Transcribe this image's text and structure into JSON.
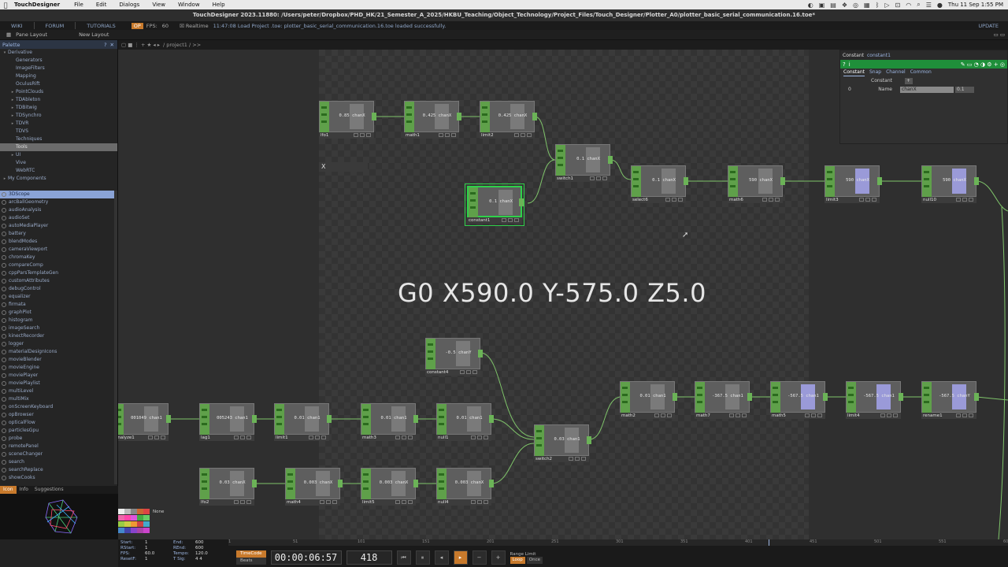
{
  "menubar": {
    "app_name": "TouchDesigner",
    "items": [
      "File",
      "Edit",
      "Dialogs",
      "View",
      "Window",
      "Help"
    ],
    "clock": "Thu 11 Sep  1:55 PM"
  },
  "window": {
    "title": "TouchDesigner 2023.11880: /Users/peter/Dropbox/PHD_HK/21_Semester_A_2025/HKBU_Teaching/Object_Technology/Project_Files/Touch_Designer/Plotter_A0/plotter_basic_serial_communication.16.toe*"
  },
  "toolbar1": {
    "wiki": "WIKI",
    "forum": "FORUM",
    "tutorials": "TUTORIALS",
    "badge": "OP",
    "fps_label": "FPS:",
    "fps_value": "60",
    "realtime": "Realtime",
    "status": "11:47:08 Load Project .toe: plotter_basic_serial_communication.16.toe loaded successfully.",
    "update": "UPDATE"
  },
  "toolbar2": {
    "pane_layout": "Pane Layout",
    "new_layout": "New Layout"
  },
  "pathbar": {
    "path": "/ project1 / >>"
  },
  "palette": {
    "title": "Palette",
    "tree": [
      {
        "label": "Derivative",
        "arrow": "▾",
        "indent": 0
      },
      {
        "label": "Generators",
        "arrow": "",
        "indent": 1
      },
      {
        "label": "ImageFilters",
        "arrow": "",
        "indent": 1
      },
      {
        "label": "Mapping",
        "arrow": "",
        "indent": 1
      },
      {
        "label": "OculusRift",
        "arrow": "",
        "indent": 1
      },
      {
        "label": "PointClouds",
        "arrow": "▸",
        "indent": 1
      },
      {
        "label": "TDAbleton",
        "arrow": "▸",
        "indent": 1
      },
      {
        "label": "TDBitwig",
        "arrow": "▸",
        "indent": 1
      },
      {
        "label": "TDSynchro",
        "arrow": "▸",
        "indent": 1
      },
      {
        "label": "TDVR",
        "arrow": "▸",
        "indent": 1
      },
      {
        "label": "TDVS",
        "arrow": "",
        "indent": 1
      },
      {
        "label": "Techniques",
        "arrow": "",
        "indent": 1
      },
      {
        "label": "Tools",
        "arrow": "",
        "indent": 1,
        "selected": true
      },
      {
        "label": "UI",
        "arrow": "▸",
        "indent": 1
      },
      {
        "label": "Vive",
        "arrow": "",
        "indent": 1
      },
      {
        "label": "WebRTC",
        "arrow": "",
        "indent": 1
      },
      {
        "label": "My Components",
        "arrow": "▸",
        "indent": 0
      }
    ],
    "components": [
      "3DScope",
      "arcBallGeometry",
      "audioAnalysis",
      "audioSet",
      "autoMediaPlayer",
      "battery",
      "blendModes",
      "cameraViewport",
      "chromaKey",
      "compareComp",
      "cppParsTemplateGen",
      "customAttributes",
      "debugControl",
      "equalizer",
      "firmata",
      "graphPlot",
      "histogram",
      "imageSearch",
      "kinectRecorder",
      "logger",
      "materialDesignIcons",
      "movieBlender",
      "movieEngine",
      "moviePlayer",
      "moviePlaylist",
      "multiLevel",
      "multiMix",
      "onScreenKeyboard",
      "opBrowser",
      "opticalFlow",
      "particlesGpu",
      "probe",
      "remotePanel",
      "sceneChanger",
      "search",
      "searchReplace",
      "showCooks"
    ],
    "bottom_tabs": [
      "Icon",
      "Info",
      "Suggestions"
    ]
  },
  "network": {
    "overlay_text": "G0 X590.0 Y-575.0 Z5.0",
    "close_x": "X",
    "nodes": [
      {
        "id": "lfo1",
        "value": "0.85 chanX",
        "style": ""
      },
      {
        "id": "math1",
        "value": "0.425 chanX",
        "style": ""
      },
      {
        "id": "limit2",
        "value": "0.425 chanX",
        "style": ""
      },
      {
        "id": "switch1",
        "value": "0.1 chanX",
        "style": ""
      },
      {
        "id": "constant1",
        "value": "0.1 chanX",
        "style": "selected"
      },
      {
        "id": "select6",
        "value": "0.1 chanX",
        "style": ""
      },
      {
        "id": "math6",
        "value": "590 chanX",
        "style": ""
      },
      {
        "id": "limit3",
        "value": "590 chanX",
        "style": "violet"
      },
      {
        "id": "null10",
        "value": "590 chanX",
        "style": "violet"
      },
      {
        "id": "constant4",
        "value": "-0.5 chanY",
        "style": ""
      },
      {
        "id": "analyze1",
        "value": "001049 chan1",
        "style": ""
      },
      {
        "id": "lag1",
        "value": "005243 chan1",
        "style": ""
      },
      {
        "id": "limit1",
        "value": "0.01 chan1",
        "style": ""
      },
      {
        "id": "math3",
        "value": "0.01 chan1",
        "style": ""
      },
      {
        "id": "null1",
        "value": "0.01 chan1",
        "style": ""
      },
      {
        "id": "switch2",
        "value": "0.03 chan1",
        "style": ""
      },
      {
        "id": "math2",
        "value": "0.01 chan1",
        "style": ""
      },
      {
        "id": "math7",
        "value": "-367.5 chan1",
        "style": ""
      },
      {
        "id": "math5",
        "value": "-567.5 chan1",
        "style": "violet"
      },
      {
        "id": "limit4",
        "value": "-567.5 chan1",
        "style": "violet"
      },
      {
        "id": "rename1",
        "value": "-567.5 chanY",
        "style": "violet"
      },
      {
        "id": "lfo2",
        "value": "0.03 chanX",
        "style": ""
      },
      {
        "id": "math4",
        "value": "0.003 chanX",
        "style": ""
      },
      {
        "id": "limit5",
        "value": "0.003 chanX",
        "style": ""
      },
      {
        "id": "null4",
        "value": "0.003 chanX",
        "style": ""
      }
    ]
  },
  "params": {
    "op_type": "Constant",
    "op_name": "constant1",
    "tabs": [
      "Constant",
      "Snap",
      "Channel",
      "Common"
    ],
    "section": "Constant",
    "row_index": "0",
    "name_label": "Name",
    "name_value": "chanX",
    "value": "0.1"
  },
  "swatches": {
    "none_label": "None"
  },
  "timeline": {
    "start_label": "Start:",
    "start": "1",
    "end_label": "End:",
    "end": "600",
    "rstart_label": "RStart:",
    "rstart": "1",
    "rend_label": "REnd:",
    "rend": "600",
    "fps_label": "FPS:",
    "fps": "60.0",
    "tempo_label": "Tempo:",
    "tempo": "120.0",
    "resetf_label": "ResetF:",
    "resetf": "1",
    "tsig_label": "T Sig:",
    "tsig": "4   4",
    "timecode": "TimeCode",
    "beats": "Beats",
    "clock": "00:00:06:57",
    "frame": "418",
    "range_limit": "Range Limit",
    "loop": "Loop",
    "once": "Once",
    "ticks": [
      "1",
      "51",
      "101",
      "151",
      "201",
      "251",
      "301",
      "351",
      "401",
      "451",
      "501",
      "551",
      "600"
    ]
  }
}
